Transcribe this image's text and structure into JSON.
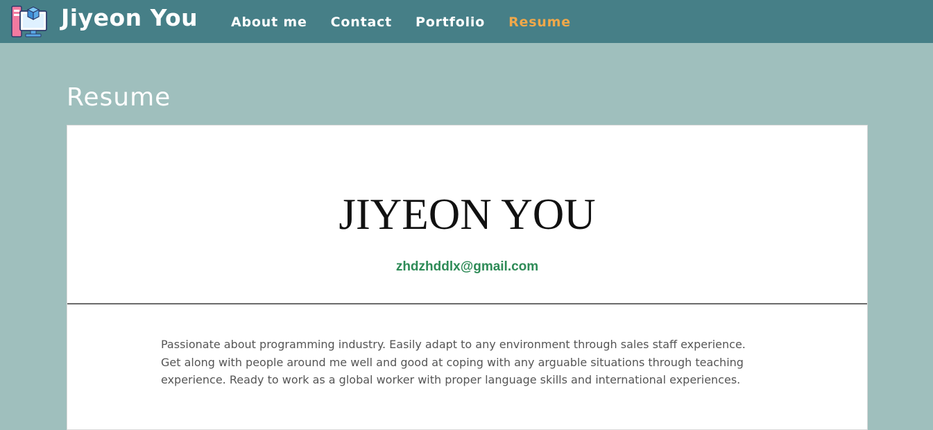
{
  "header": {
    "brand": "Jiyeon You",
    "logo_icon": "desktop-portfolio-icon",
    "nav": [
      {
        "label": "About me",
        "active": false
      },
      {
        "label": "Contact",
        "active": false
      },
      {
        "label": "Portfolio",
        "active": false
      },
      {
        "label": "Resume",
        "active": true
      }
    ],
    "colors": {
      "navbar": "#467f87",
      "active": "#f0a84a",
      "page_bg": "#9fbfbd"
    }
  },
  "main": {
    "title": "Resume"
  },
  "resume": {
    "name": "JIYEON YOU",
    "email": "zhdzhddlx@gmail.com",
    "summary": "Passionate about programming industry. Easily adapt to any environment through sales staff experience. Get along with people around me well and good at coping with any arguable situations through teaching experience. Ready to work as a global worker with proper language skills and international experiences.",
    "email_color": "#2e8b57"
  }
}
